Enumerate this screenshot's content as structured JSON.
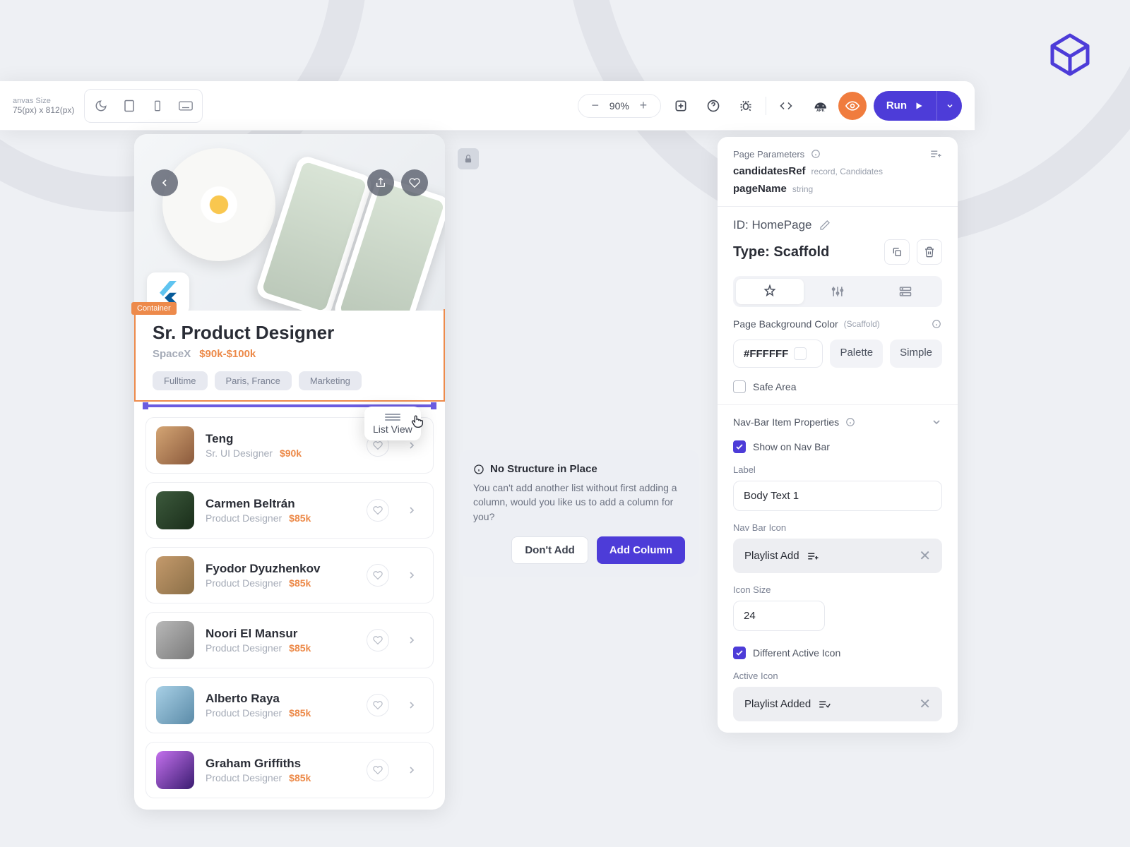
{
  "toolbar": {
    "canvas_size_label": "anvas Size",
    "canvas_size_value": "75(px) x 812(px)",
    "zoom": "90%",
    "run_label": "Run"
  },
  "canvas": {
    "container_tag": "Container",
    "job_title": "Sr. Product Designer",
    "company": "SpaceX",
    "salary": "$90k-$100k",
    "tags": [
      "Fulltime",
      "Paris, France",
      "Marketing"
    ],
    "listview_tip": "List View",
    "candidates": [
      {
        "name": "Teng",
        "role": "Sr. UI Designer",
        "salary": "$90k"
      },
      {
        "name": "Carmen Beltrán",
        "role": "Product Designer",
        "salary": "$85k"
      },
      {
        "name": "Fyodor Dyuzhenkov",
        "role": "Product Designer",
        "salary": "$85k"
      },
      {
        "name": "Noori El Mansur",
        "role": "Product Designer",
        "salary": "$85k"
      },
      {
        "name": "Alberto Raya",
        "role": "Product Designer",
        "salary": "$85k"
      },
      {
        "name": "Graham Griffiths",
        "role": "Product Designer",
        "salary": "$85k"
      }
    ]
  },
  "dialog": {
    "title": "No Structure in Place",
    "body": "You can't add another list without first adding a column, would you like us to add a column for you?",
    "cancel": "Don't Add",
    "confirm": "Add Column"
  },
  "panel": {
    "page_params_title": "Page Parameters",
    "params": [
      {
        "name": "candidatesRef",
        "type": "record, Candidates"
      },
      {
        "name": "pageName",
        "type": "string"
      }
    ],
    "id_label": "ID: HomePage",
    "type_label": "Type: Scaffold",
    "bg_section_title": "Page Background Color",
    "bg_section_hint": "(Scaffold)",
    "color_hex": "#FFFFFF",
    "palette_btn": "Palette",
    "simple_btn": "Simple",
    "safe_area": "Safe Area",
    "navbar_section_title": "Nav-Bar Item Properties",
    "show_nav": "Show on Nav Bar",
    "label_field_title": "Label",
    "label_value": "Body Text 1",
    "navicon_field_title": "Nav Bar Icon",
    "navicon_value": "Playlist Add",
    "icon_size_title": "Icon Size",
    "icon_size_value": "24",
    "diff_active": "Different Active Icon",
    "active_icon_title": "Active Icon",
    "active_icon_value": "Playlist Added"
  }
}
